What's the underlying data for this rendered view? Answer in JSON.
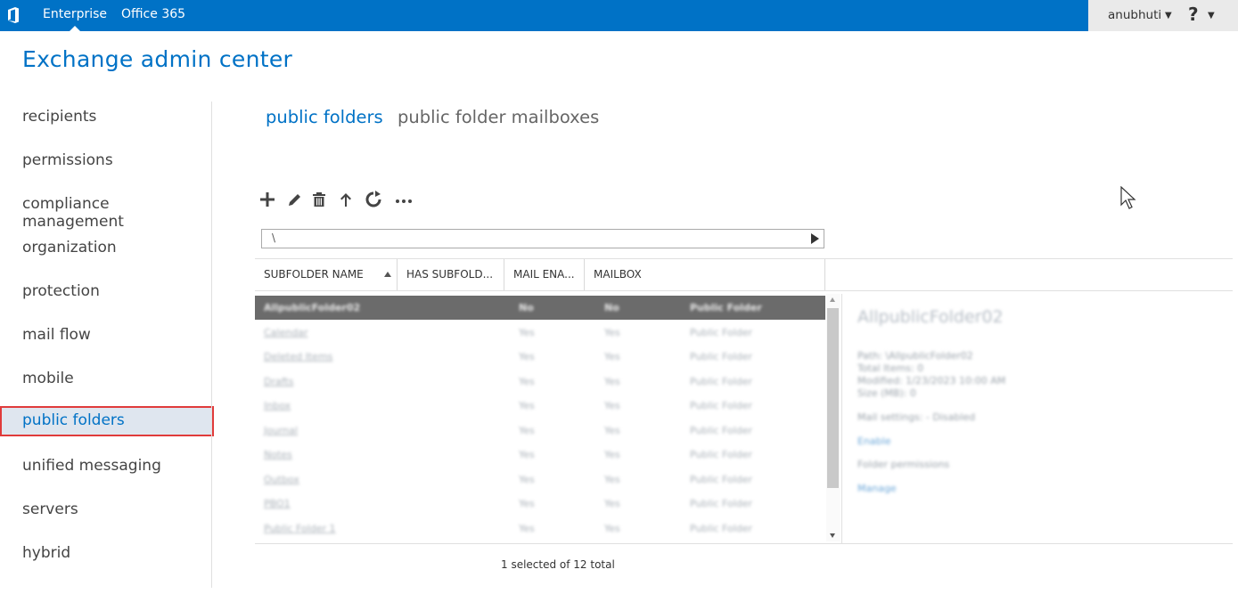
{
  "topbar": {
    "links": [
      "Enterprise",
      "Office 365"
    ],
    "username": "anubhuti",
    "help_label": "?"
  },
  "app_title": "Exchange admin center",
  "nav": {
    "items": [
      "recipients",
      "permissions",
      "compliance management",
      "organization",
      "protection",
      "mail flow",
      "mobile",
      "public folders",
      "unified messaging",
      "servers",
      "hybrid"
    ],
    "selected": "public folders"
  },
  "tabs": [
    "public folders",
    "public folder mailboxes"
  ],
  "toolbar": {
    "icons": [
      "add-icon",
      "edit-icon",
      "delete-icon",
      "up-icon",
      "refresh-icon",
      "more-icon"
    ]
  },
  "path": {
    "value": "\\"
  },
  "grid": {
    "columns": [
      "SUBFOLDER NAME",
      "HAS SUBFOLD...",
      "MAIL ENA...",
      "MAILBOX"
    ],
    "sort_column": "SUBFOLDER NAME",
    "rows": [
      {
        "name": "AllpublicFolder02",
        "has_sub": "No",
        "mail_enabled": "No",
        "mailbox": "Public Folder"
      },
      {
        "name": "Calendar",
        "has_sub": "Yes",
        "mail_enabled": "Yes",
        "mailbox": "Public Folder"
      },
      {
        "name": "Deleted Items",
        "has_sub": "Yes",
        "mail_enabled": "Yes",
        "mailbox": "Public Folder"
      },
      {
        "name": "Drafts",
        "has_sub": "Yes",
        "mail_enabled": "Yes",
        "mailbox": "Public Folder"
      },
      {
        "name": "Inbox",
        "has_sub": "Yes",
        "mail_enabled": "Yes",
        "mailbox": "Public Folder"
      },
      {
        "name": "Journal",
        "has_sub": "Yes",
        "mail_enabled": "Yes",
        "mailbox": "Public Folder"
      },
      {
        "name": "Notes",
        "has_sub": "Yes",
        "mail_enabled": "Yes",
        "mailbox": "Public Folder"
      },
      {
        "name": "Outbox",
        "has_sub": "Yes",
        "mail_enabled": "Yes",
        "mailbox": "Public Folder"
      },
      {
        "name": "PBO1",
        "has_sub": "Yes",
        "mail_enabled": "Yes",
        "mailbox": "Public Folder"
      },
      {
        "name": "Public Folder 1",
        "has_sub": "Yes",
        "mail_enabled": "Yes",
        "mailbox": "Public Folder"
      }
    ]
  },
  "details": {
    "title": "AllpublicFolder02",
    "path": "Path: \\AllpublicFolder02",
    "total_items": "Total Items: 0",
    "modified": "Modified: 1/23/2023 10:00 AM",
    "size": "Size (MB): 0",
    "mail_settings": "Mail settings: - Disabled",
    "enable_link": "Enable",
    "folder_permissions": "Folder permissions",
    "manage_link": "Manage"
  },
  "status": "1 selected of 12 total",
  "colors": {
    "brand": "#0072c6",
    "selection_outline": "#e03b3b",
    "selected_row": "#6b6b6b"
  }
}
